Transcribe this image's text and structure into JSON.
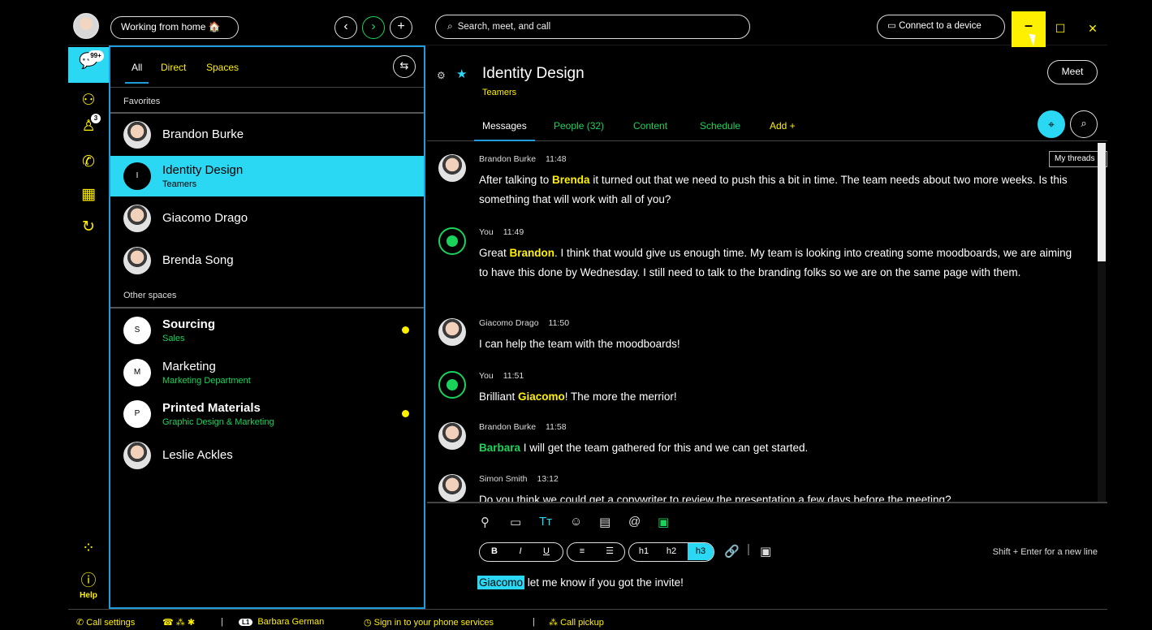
{
  "titlebar": {
    "status": "Working from home 🏠",
    "search_placeholder": "Search, meet, and call",
    "connect_label": "Connect to a device",
    "min_label": "–",
    "max_label": "☐",
    "close_label": "✕"
  },
  "rail": {
    "messages_badge": "99+",
    "contacts_badge": "3",
    "help_label": "Help"
  },
  "list": {
    "filters": [
      "All",
      "Direct",
      "Spaces"
    ],
    "favorites_label": "Favorites",
    "other_label": "Other spaces",
    "favorites": [
      {
        "name": "Brandon Burke"
      },
      {
        "name": "Identity Design",
        "sub": "Teamers",
        "letter": "I"
      },
      {
        "name": "Giacomo Drago"
      },
      {
        "name": "Brenda Song"
      }
    ],
    "others": [
      {
        "name": "Sourcing",
        "sub": "Sales",
        "letter": "S"
      },
      {
        "name": "Marketing",
        "sub": "Marketing Department",
        "letter": "M"
      },
      {
        "name": "Printed Materials",
        "sub": "Graphic Design & Marketing",
        "letter": "P"
      },
      {
        "name": "Leslie Ackles"
      }
    ]
  },
  "space": {
    "title": "Identity Design",
    "subtitle": "Teamers",
    "meet_label": "Meet",
    "tabs": [
      "Messages",
      "People (32)",
      "Content",
      "Schedule",
      "Add +"
    ],
    "tooltip": "My threads"
  },
  "messages": [
    {
      "author": "Brandon Burke",
      "time": "11:48",
      "pre": "After talking to ",
      "mention": "Brenda",
      "post": " it turned out that we need to push this a bit in time. The team needs about two more weeks. Is this something that will work with all of you?"
    },
    {
      "author": "You",
      "time": "11:49",
      "pre": "Great ",
      "mention": "Brandon",
      "post": ". I think that would give us enough time. My team is looking into creating some moodboards, we are aiming to have this done by Wednesday. I still need to talk to the branding folks so we are on the same page with them."
    },
    {
      "author": "Giacomo Drago",
      "time": "11:50",
      "pre": "I can help the team with the moodboards!",
      "mention": "",
      "post": ""
    },
    {
      "author": "You",
      "time": "11:51",
      "pre": "Brilliant ",
      "mention": "Giacomo",
      "post": "! The more the merrior!"
    },
    {
      "author": "Brandon Burke",
      "time": "11:58",
      "pre": "",
      "mention": "Barbara",
      "post": " I will get the team gathered for this and we can get started."
    },
    {
      "author": "Simon Smith",
      "time": "13:12",
      "pre": "Do you think we could get a copywriter to review the presentation a few days before the meeting?",
      "mention": "",
      "post": ""
    }
  ],
  "composer": {
    "hint": "Shift + Enter for a new line",
    "mention": "Giacomo",
    "text": " let me know if you got the invite!",
    "format_cells": [
      "B",
      "I",
      "U",
      "≡",
      "☰",
      "h1",
      "h2",
      "h3"
    ]
  },
  "statusbar": {
    "call_settings": "Call settings",
    "line_badge": "L1",
    "user": "Barbara German",
    "sign_in": "Sign in to your phone services",
    "call_pickup": "Call pickup"
  },
  "colors": {
    "accent_cyan": "#2bd8f4",
    "accent_yellow": "#fff000",
    "accent_green": "#19d35a",
    "border_blue": "#1e9cdc"
  }
}
